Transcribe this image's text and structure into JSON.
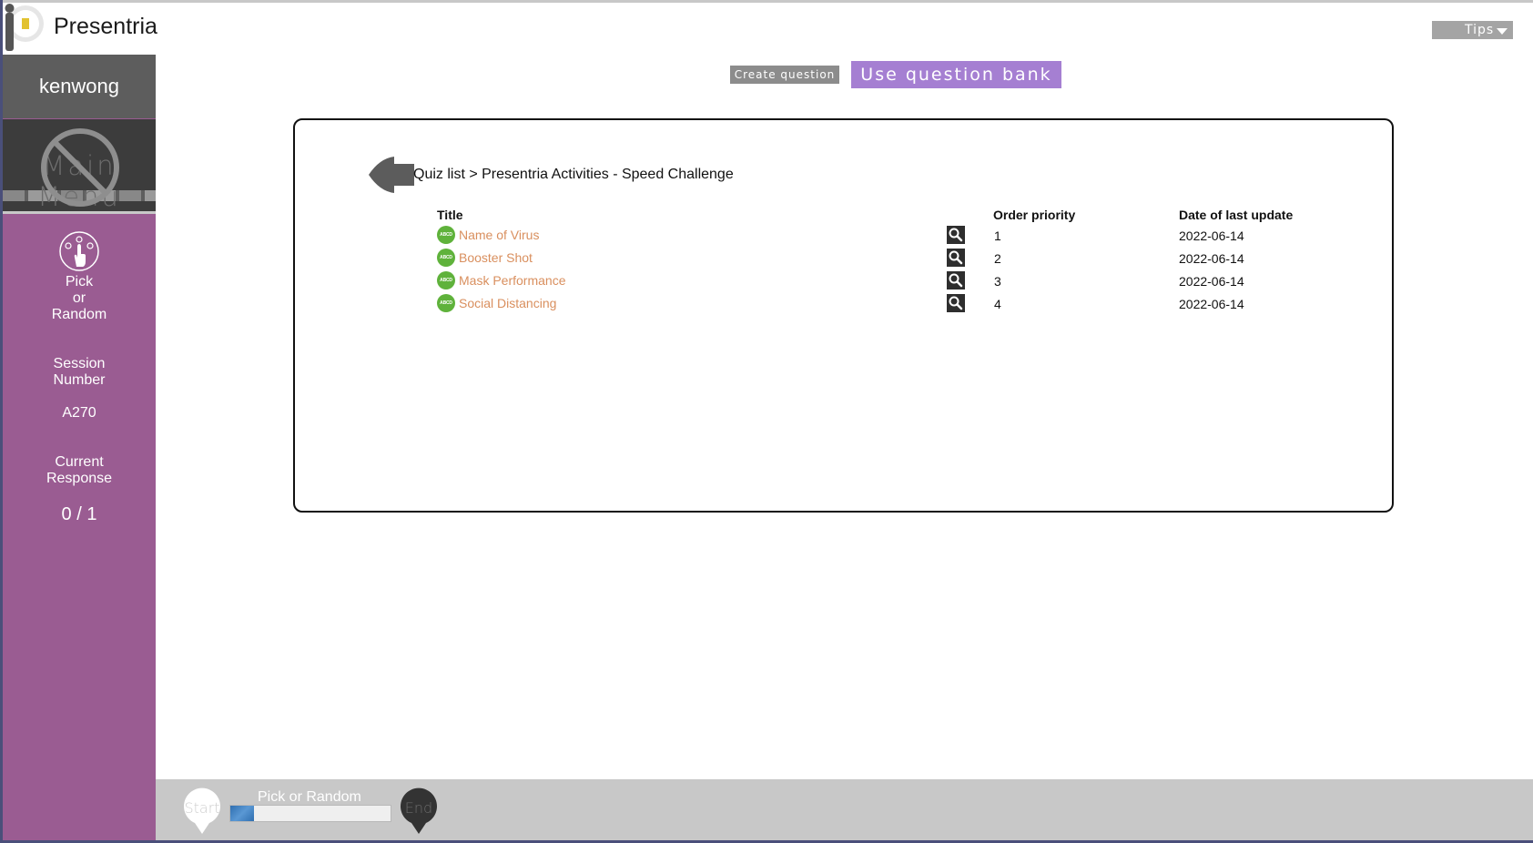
{
  "app": {
    "name": "Presentria"
  },
  "header": {
    "tips_label": "Tips",
    "create_question_label": "Create question",
    "use_question_bank_label": "Use question bank"
  },
  "sidebar": {
    "username": "kenwong",
    "main_menu_label": "Main Menu",
    "pick_random_lines": [
      "Pick",
      "or",
      "Random"
    ],
    "session_label_lines": [
      "Session",
      "Number"
    ],
    "session_number": "A270",
    "current_response_lines": [
      "Current",
      "Response"
    ],
    "current_response_value": "0 / 1"
  },
  "main": {
    "breadcrumb": "Quiz list > Presentria Activities - Speed Challenge",
    "columns": {
      "title": "Title",
      "order_priority": "Order priority",
      "date": "Date of last update"
    },
    "rows": [
      {
        "title": "Name of Virus",
        "order": "1",
        "date": "2022-06-14"
      },
      {
        "title": "Booster Shot",
        "order": "2",
        "date": "2022-06-14"
      },
      {
        "title": "Mask Performance",
        "order": "3",
        "date": "2022-06-14"
      },
      {
        "title": "Social Distancing",
        "order": "4",
        "date": "2022-06-14"
      }
    ],
    "question_type_icon": "abcd-choice-icon",
    "preview_icon": "magnifier-icon"
  },
  "bottom_bar": {
    "start_label": "Start",
    "end_label": "End",
    "progress_label": "Pick or Random",
    "progress_fraction": 0.15
  },
  "colors": {
    "sidebar": "#9a5c92",
    "accent_purple": "#a57fd2",
    "title_link": "#d98f5e",
    "question_icon_green": "#5fb23b"
  }
}
